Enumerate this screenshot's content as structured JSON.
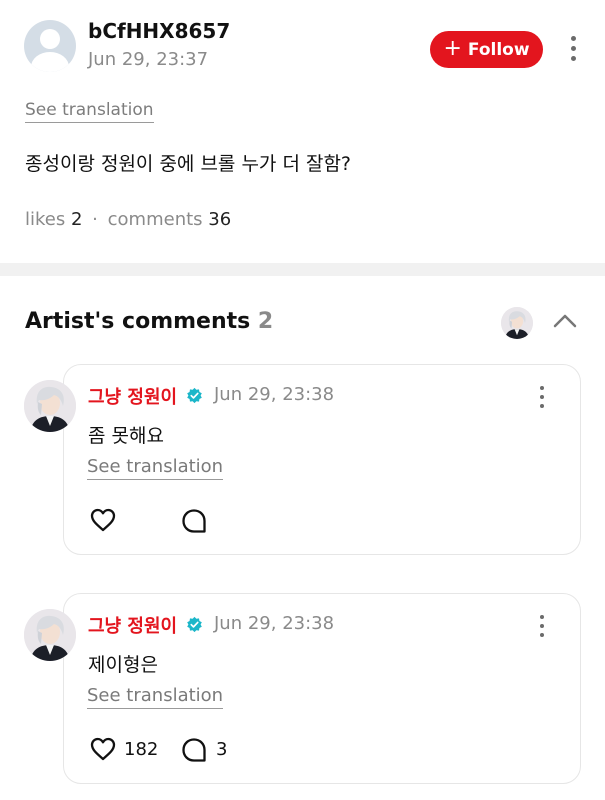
{
  "post": {
    "username": "bCfHHX8657",
    "timestamp": "Jun 29, 23:37",
    "follow_label": "Follow",
    "see_translation": "See translation",
    "text": "종성이랑 정원이 중에 브롤 누가 더 잘함?",
    "likes_label": "likes",
    "likes_count": "2",
    "separator": "·",
    "comments_label": "comments",
    "comments_count": "36"
  },
  "artist_comments": {
    "title": "Artist's comments",
    "count": "2",
    "comments": [
      {
        "author": "그냥 정원이",
        "time": "Jun 29, 23:38",
        "text": "좀 못해요",
        "see_translation": "See translation",
        "likes": "",
        "replies": ""
      },
      {
        "author": "그냥 정원이",
        "time": "Jun 29, 23:38",
        "text": "제이형은",
        "see_translation": "See translation",
        "likes": "182",
        "replies": "3"
      }
    ]
  },
  "colors": {
    "accent": "#e3151e",
    "verified": "#1bb6c9",
    "muted_text": "#8a8a8a"
  },
  "icons": {
    "more": "more-vertical-icon",
    "chevron": "chevron-up-icon",
    "like": "heart-icon",
    "reply": "comment-bubble-icon",
    "verified": "verified-badge-icon"
  }
}
